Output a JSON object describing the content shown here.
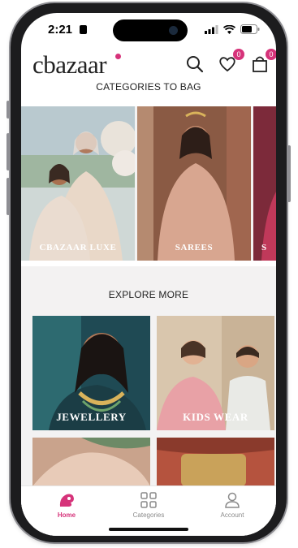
{
  "status_bar": {
    "time": "2:21"
  },
  "header": {
    "logo": "cbazaar",
    "wishlist_count": "0",
    "bag_count": "0"
  },
  "categories": {
    "title": "CATEGORIES TO BAG",
    "items": [
      {
        "label": "CBAZAAR LUXE"
      },
      {
        "label": "SAREES"
      },
      {
        "label": "S"
      }
    ]
  },
  "explore": {
    "title": "EXPLORE MORE",
    "tiles": [
      {
        "label": "JEWELLERY"
      },
      {
        "label": "KIDS WEAR"
      },
      {
        "label": ""
      },
      {
        "label": ""
      }
    ]
  },
  "tabbar": {
    "items": [
      {
        "label": "Home",
        "icon": "home-icon",
        "active": true
      },
      {
        "label": "Categories",
        "icon": "grid-icon",
        "active": false
      },
      {
        "label": "Account",
        "icon": "user-icon",
        "active": false
      }
    ]
  },
  "colors": {
    "accent": "#d6337a",
    "background": "#f3f2f2"
  }
}
